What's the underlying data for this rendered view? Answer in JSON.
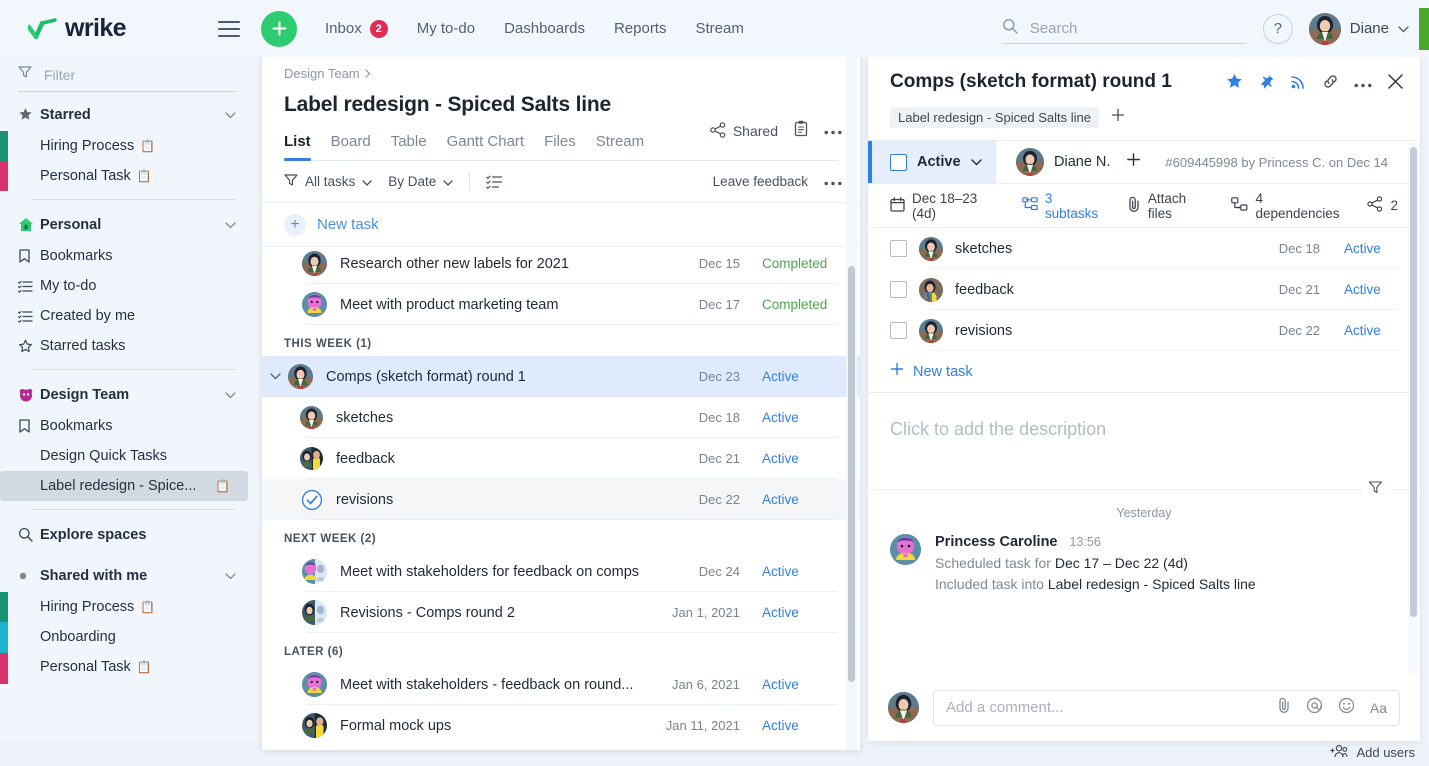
{
  "topbar": {
    "logo_text": "wrike",
    "menu_icon": "hamburger-icon",
    "create_label": "+",
    "nav": [
      {
        "label": "Inbox",
        "badge": "2"
      },
      {
        "label": "My to-do"
      },
      {
        "label": "Dashboards"
      },
      {
        "label": "Reports"
      },
      {
        "label": "Stream"
      }
    ],
    "search": {
      "placeholder": "Search",
      "value": ""
    },
    "help_label": "?",
    "user": {
      "name": "Diane"
    }
  },
  "sidebar": {
    "filter": {
      "placeholder": "Filter",
      "value": ""
    },
    "groups": [
      {
        "id": "starred",
        "label": "Starred",
        "icon": "star-icon",
        "items": [
          {
            "label": "Hiring Process",
            "doc": true,
            "strip": "#199473"
          },
          {
            "label": "Personal Task",
            "doc": true,
            "strip": "#d8326a"
          }
        ]
      },
      {
        "id": "personal",
        "label": "Personal",
        "icon": "home-icon",
        "items": [
          {
            "label": "Bookmarks",
            "icon": "bookmark-icon"
          },
          {
            "label": "My to-do",
            "icon": "list-icon"
          },
          {
            "label": "Created by me",
            "icon": "list-icon"
          },
          {
            "label": "Starred tasks",
            "icon": "star-outline-icon"
          }
        ]
      },
      {
        "id": "design-team",
        "label": "Design Team",
        "icon": "space-icon",
        "items": [
          {
            "label": "Bookmarks",
            "icon": "bookmark-icon"
          },
          {
            "label": "Design Quick Tasks"
          },
          {
            "label": "Label redesign - Spice...",
            "doc": true,
            "active": true
          }
        ]
      }
    ],
    "explore_label": "Explore spaces",
    "shared": {
      "label": "Shared with me",
      "items": [
        {
          "label": "Hiring Process",
          "doc": true,
          "strip": "#199473"
        },
        {
          "label": "Onboarding",
          "strip": "#1bb3ce"
        },
        {
          "label": "Personal Task",
          "doc": true,
          "strip": "#d8326a"
        }
      ]
    }
  },
  "center": {
    "breadcrumb": "Design Team",
    "title": "Label redesign - Spiced Salts line",
    "shared_label": "Shared",
    "tabs": [
      {
        "label": "List",
        "selected": true
      },
      {
        "label": "Board"
      },
      {
        "label": "Table"
      },
      {
        "label": "Gantt Chart"
      },
      {
        "label": "Files"
      },
      {
        "label": "Stream"
      }
    ],
    "toolbar": {
      "filter_label": "All tasks",
      "sort_label": "By Date",
      "feedback_label": "Leave feedback"
    },
    "new_task_label": "New task",
    "sections": [
      {
        "header": null,
        "rows": [
          {
            "name": "Research other new labels for 2021",
            "date": "Dec 15",
            "status": "Completed",
            "status_kind": "completed",
            "avatar": "diane"
          },
          {
            "name": "Meet with product marketing team",
            "date": "Dec 17",
            "status": "Completed",
            "status_kind": "completed",
            "avatar": "caroline"
          }
        ]
      },
      {
        "header": "THIS WEEK (1)",
        "rows": [
          {
            "name": "Comps (sketch format) round 1",
            "date": "Dec 23",
            "status": "Active",
            "status_kind": "active",
            "avatar": "diane",
            "selected": true,
            "expandable": true
          },
          {
            "name": "sketches",
            "date": "Dec 18",
            "status": "Active",
            "status_kind": "active",
            "avatar": "diane",
            "sub": true
          },
          {
            "name": "feedback",
            "date": "Dec 21",
            "status": "Active",
            "status_kind": "active",
            "avatar": "mixed",
            "sub": true
          },
          {
            "name": "revisions",
            "date": "Dec 22",
            "status": "Active",
            "status_kind": "active",
            "avatar": "check",
            "sub": true,
            "hovered": true
          }
        ]
      },
      {
        "header": "NEXT WEEK (2)",
        "rows": [
          {
            "name": "Meet with stakeholders for feedback on comps",
            "date": "Dec 24",
            "status": "Active",
            "status_kind": "active",
            "avatar": "caroline"
          },
          {
            "name": "Revisions - Comps round 2",
            "date": "Jan 1, 2021",
            "status": "Active",
            "status_kind": "active",
            "avatar": "mixed"
          }
        ]
      },
      {
        "header": "LATER (6)",
        "rows": [
          {
            "name": "Meet with stakeholders - feedback on round...",
            "date": "Jan 6, 2021",
            "status": "Active",
            "status_kind": "active",
            "avatar": "caroline"
          },
          {
            "name": "Formal mock ups",
            "date": "Jan 11, 2021",
            "status": "Active",
            "status_kind": "active",
            "avatar": "mixed"
          }
        ]
      }
    ]
  },
  "detail": {
    "title": "Comps (sketch format) round 1",
    "tag": "Label redesign - Spiced Salts line",
    "add_tag_label": "+",
    "status": "Active",
    "assignee": "Diane N.",
    "meta": "#609445998 by Princess C. on Dec 14",
    "props": {
      "dates": "Dec 18–23 (4d)",
      "subtasks": "3 subtasks",
      "attach": "Attach files",
      "dependencies": "4 dependencies",
      "share_count": "2"
    },
    "subtasks": [
      {
        "name": "sketches",
        "date": "Dec 18",
        "status": "Active"
      },
      {
        "name": "feedback",
        "date": "Dec 21",
        "status": "Active"
      },
      {
        "name": "revisions",
        "date": "Dec 22",
        "status": "Active"
      }
    ],
    "new_task_label": "New task",
    "description_placeholder": "Click to add the description",
    "activity_day": "Yesterday",
    "activity": [
      {
        "author": "Princess Caroline",
        "time": "13:56",
        "lines": [
          {
            "prefix": "Scheduled task for ",
            "strong": "Dec 17 – Dec 22 (4d)"
          },
          {
            "prefix": "Included task into ",
            "strong": "Label redesign - Spiced Salts line"
          }
        ]
      }
    ],
    "comment": {
      "placeholder": "Add a comment...",
      "value": ""
    }
  },
  "footer": {
    "add_users_label": "Add users"
  },
  "colors": {
    "accent_green": "#2ecc71",
    "accent_blue": "#2f7fe8",
    "completed_green": "#4aa84a",
    "badge_red": "#e02b55",
    "strip_teal": "#199473",
    "strip_cyan": "#1bb3ce",
    "strip_pink": "#d8326a"
  }
}
